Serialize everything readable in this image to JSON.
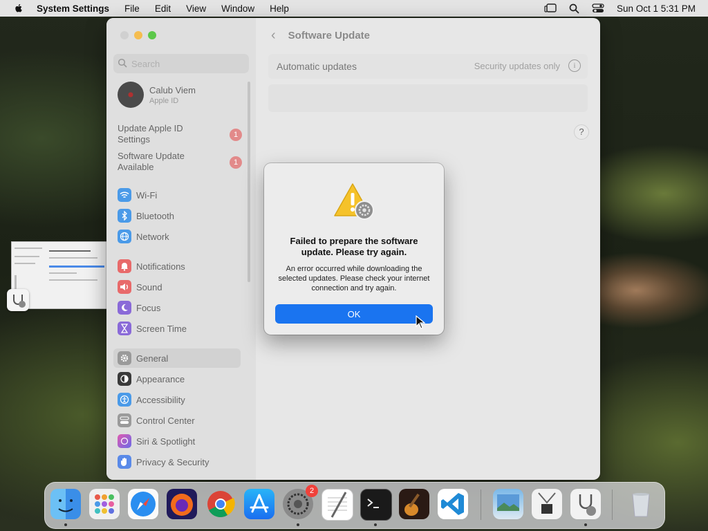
{
  "menubar": {
    "app_name": "System Settings",
    "menus": [
      "File",
      "Edit",
      "View",
      "Window",
      "Help"
    ],
    "datetime": "Sun Oct 1  5:31 PM"
  },
  "window": {
    "search_placeholder": "Search",
    "account": {
      "name": "Calub Viem",
      "subtitle": "Apple ID"
    },
    "notices": [
      {
        "label": "Update Apple ID Settings",
        "badge": "1"
      },
      {
        "label": "Software Update Available",
        "badge": "1"
      }
    ],
    "sidebar_items": [
      {
        "label": "Wi-Fi",
        "icon": "wifi-icon",
        "color": "#4a9ae8"
      },
      {
        "label": "Bluetooth",
        "icon": "bluetooth-icon",
        "color": "#4a9ae8"
      },
      {
        "label": "Network",
        "icon": "globe-icon",
        "color": "#4a9ae8"
      },
      {
        "label": "Notifications",
        "icon": "bell-icon",
        "color": "#e86a6a"
      },
      {
        "label": "Sound",
        "icon": "speaker-icon",
        "color": "#e86a6a"
      },
      {
        "label": "Focus",
        "icon": "moon-icon",
        "color": "#8a6ad8"
      },
      {
        "label": "Screen Time",
        "icon": "hourglass-icon",
        "color": "#8a6ad8"
      },
      {
        "label": "General",
        "icon": "gear-icon",
        "color": "#9a9a9a"
      },
      {
        "label": "Appearance",
        "icon": "appearance-icon",
        "color": "#3a3a3a"
      },
      {
        "label": "Accessibility",
        "icon": "accessibility-icon",
        "color": "#4a9ae8"
      },
      {
        "label": "Control Center",
        "icon": "control-center-icon",
        "color": "#9a9a9a"
      },
      {
        "label": "Siri & Spotlight",
        "icon": "siri-icon",
        "color": "#c05ac0"
      },
      {
        "label": "Privacy & Security",
        "icon": "hand-icon",
        "color": "#5a8ae8"
      }
    ],
    "selected_item": "General",
    "page_title": "Software Update",
    "auto_updates_label": "Automatic updates",
    "auto_updates_value": "Security updates only",
    "help_label": "?"
  },
  "dialog": {
    "title": "Failed to prepare the software update. Please try again.",
    "message": "An error occurred while downloading the selected updates. Please check your internet connection and try again.",
    "ok_label": "OK"
  },
  "dock": {
    "apps": [
      "Finder",
      "Launchpad",
      "Safari",
      "Firefox",
      "Chrome",
      "App Store",
      "System Settings",
      "TextEdit",
      "Terminal",
      "GarageBand",
      "Visual Studio Code",
      "Preview",
      "System Information",
      "Disk Utility",
      "Trash"
    ],
    "system_settings_badge": "2"
  }
}
